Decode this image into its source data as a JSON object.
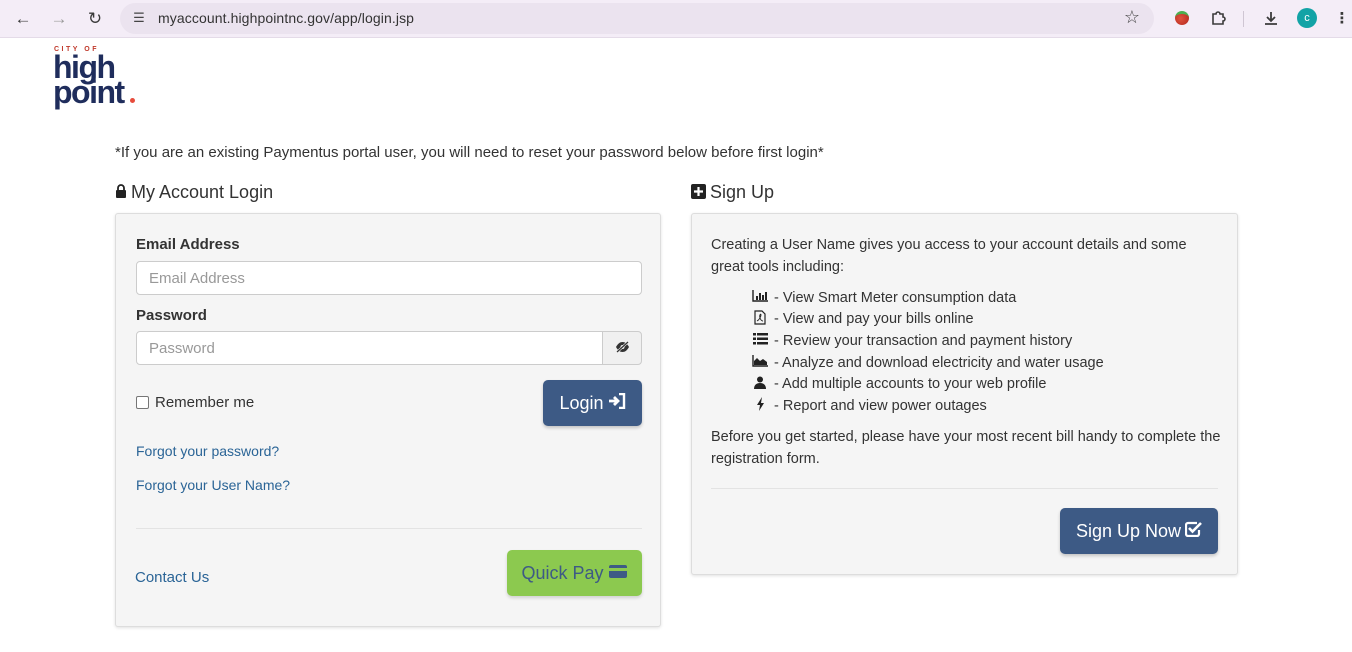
{
  "browser": {
    "url": "myaccount.highpointnc.gov/app/login.jsp",
    "profile_initial": "c"
  },
  "logo": {
    "city_of": "CITY OF",
    "line1": "high",
    "line2": "point",
    "dot_color": "#e74c3c"
  },
  "notice": "*If you are an existing Paymentus portal user, you will need to reset your password below before first login*",
  "login": {
    "title": "My Account Login",
    "email_label": "Email Address",
    "email_placeholder": "Email Address",
    "email_value": "",
    "password_label": "Password",
    "password_placeholder": "Password",
    "password_value": "",
    "remember_label": "Remember me",
    "remember_checked": false,
    "login_button": "Login",
    "forgot_password": "Forgot your password?",
    "forgot_username": "Forgot your User Name?",
    "contact_us": "Contact Us",
    "quick_pay": "Quick Pay"
  },
  "signup": {
    "title": "Sign Up",
    "intro": "Creating a User Name gives you access to your account details and some great tools including:",
    "features": [
      {
        "icon": "bar-chart-icon",
        "text": "- View Smart Meter consumption data"
      },
      {
        "icon": "pdf-file-icon",
        "text": "- View and pay your bills online"
      },
      {
        "icon": "list-icon",
        "text": "- Review your transaction and payment history"
      },
      {
        "icon": "area-chart-icon",
        "text": "- Analyze and download electricity and water usage"
      },
      {
        "icon": "user-icon",
        "text": "- Add multiple accounts to your web profile"
      },
      {
        "icon": "bolt-icon",
        "text": "- Report and view power outages"
      }
    ],
    "outro": "Before you get started, please have your most recent bill handy to complete the registration form.",
    "button": "Sign Up Now"
  },
  "colors": {
    "primary_button": "#3d5a85",
    "quick_pay_button": "#8cc94f",
    "link": "#2a6496",
    "logo_navy": "#1f2d5c"
  }
}
